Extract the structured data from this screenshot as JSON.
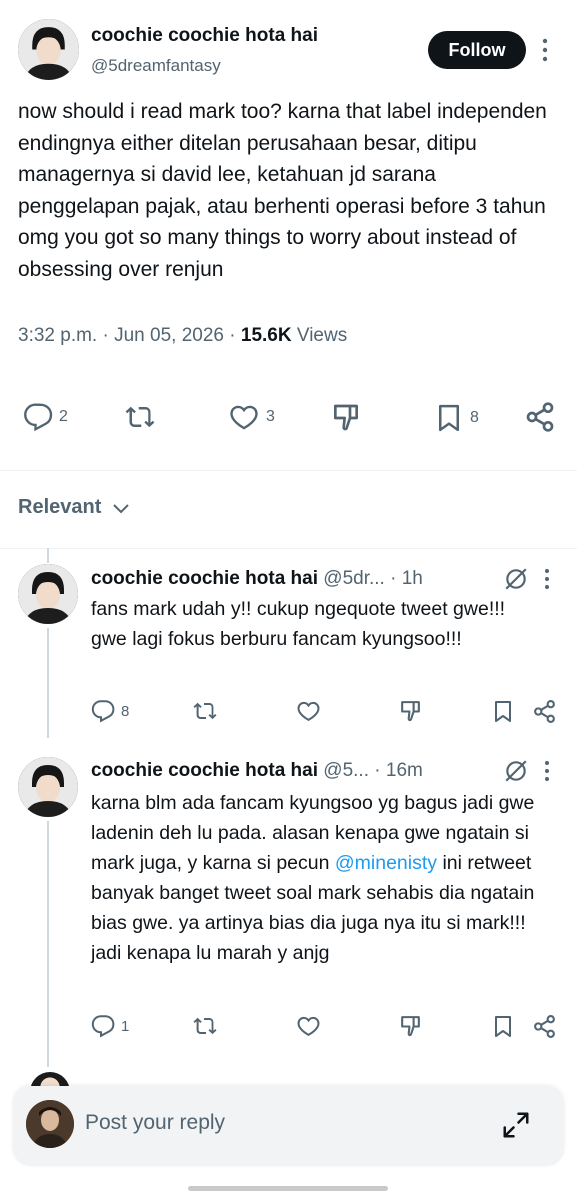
{
  "main_tweet": {
    "author_name": "coochie coochie hota hai",
    "author_handle": "@5dreamfantasy",
    "follow_label": "Follow",
    "text": "now should i read mark too? karna that label independen endingnya either ditelan perusahaan besar, ditipu managernya si david lee, ketahuan jd sarana penggelapan pajak, atau berhenti operasi before 3 tahun omg you got so many things to worry about instead of obsessing over renjun",
    "time": "3:32 p.m.",
    "date": "Jun 05, 2026",
    "views_count": "15.6K",
    "views_label": "Views",
    "stats": {
      "replies": "2",
      "likes": "3",
      "bookmarks": "8"
    }
  },
  "sort": {
    "label": "Relevant"
  },
  "replies": [
    {
      "author_name": "coochie coochie hota hai",
      "author_handle": "@5dr...",
      "age": "1h",
      "text": "fans mark udah y!! cukup ngequote tweet gwe!!! gwe lagi fokus berburu fancam kyungsoo!!!",
      "reply_count": "8"
    },
    {
      "author_name": "coochie coochie hota hai",
      "author_handle": "@5...",
      "age": "16m",
      "text_before": "karna blm ada fancam kyungsoo yg bagus jadi gwe ladenin deh lu pada. alasan kenapa gwe ngatain si mark juga, y karna si pecun ",
      "mention": "@minenisty",
      "text_after": " ini retweet banyak banget tweet soal mark sehabis dia ngatain bias gwe. ya artinya bias dia juga nya itu si mark!!! jadi kenapa lu marah y anjg",
      "reply_count": "1"
    }
  ],
  "composer": {
    "placeholder": "Post your reply"
  },
  "colors": {
    "accent": "#1d9bf0",
    "text": "#0f1419",
    "muted": "#536471"
  }
}
